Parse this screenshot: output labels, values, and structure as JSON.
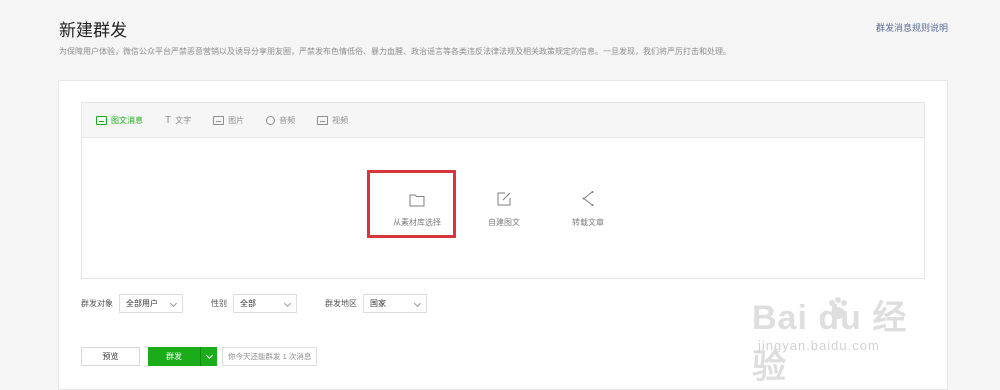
{
  "header": {
    "title": "新建群发",
    "rules_link": "群发消息规则说明",
    "notice": "为保障用户体验，微信公众平台严禁恶意营销以及诱导分享朋友圈，严禁发布色情低俗、暴力血腥、政治谣言等各类违反法律法规及相关政策规定的信息。一旦发现，我们将严厉打击和处理。"
  },
  "tabs": [
    {
      "label": "图文消息",
      "icon": "news-icon",
      "active": true
    },
    {
      "label": "文字",
      "icon": "text-icon",
      "active": false
    },
    {
      "label": "图片",
      "icon": "image-icon",
      "active": false
    },
    {
      "label": "音频",
      "icon": "audio-icon",
      "active": false
    },
    {
      "label": "视频",
      "icon": "video-icon",
      "active": false
    }
  ],
  "choices": [
    {
      "label": "从素材库选择",
      "icon": "folder-icon"
    },
    {
      "label": "自建图文",
      "icon": "edit-icon"
    },
    {
      "label": "转载文章",
      "icon": "share-icon"
    }
  ],
  "filters": {
    "target": {
      "label": "群发对象",
      "value": "全部用户"
    },
    "gender": {
      "label": "性别",
      "value": "全部"
    },
    "region": {
      "label": "群发地区",
      "value": "国家"
    }
  },
  "actions": {
    "preview": "预览",
    "send": "群发",
    "quota": "你今天还能群发 1 次消息"
  },
  "watermark": {
    "main": "Bai du 经验",
    "sub": "jingyan.baidu.com"
  },
  "colors": {
    "accent_green": "#1aad19",
    "highlight_red": "#d8363d",
    "link_blue": "#576b95"
  }
}
